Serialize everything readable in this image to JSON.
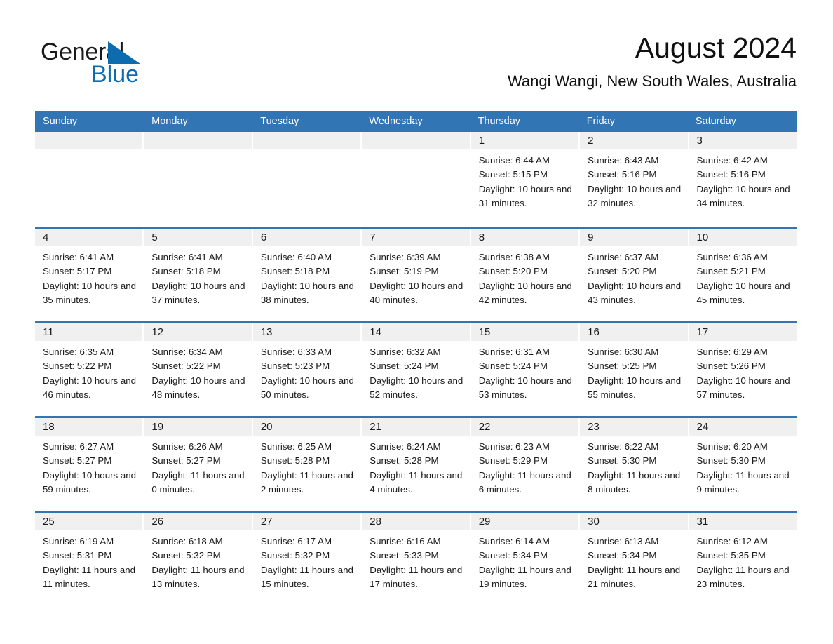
{
  "brand": {
    "name_part1": "General",
    "name_part2": "Blue",
    "triangle_icon": "triangle-icon",
    "accent_color": "#0d6bb0"
  },
  "header": {
    "title": "August 2024",
    "location": "Wangi Wangi, New South Wales, Australia"
  },
  "calendar": {
    "header_color": "#3175b4",
    "weekdays": [
      "Sunday",
      "Monday",
      "Tuesday",
      "Wednesday",
      "Thursday",
      "Friday",
      "Saturday"
    ],
    "weeks": [
      [
        {
          "day": "",
          "empty": true
        },
        {
          "day": "",
          "empty": true
        },
        {
          "day": "",
          "empty": true
        },
        {
          "day": "",
          "empty": true
        },
        {
          "day": "1",
          "sunrise": "Sunrise: 6:44 AM",
          "sunset": "Sunset: 5:15 PM",
          "daylight": "Daylight: 10 hours and 31 minutes."
        },
        {
          "day": "2",
          "sunrise": "Sunrise: 6:43 AM",
          "sunset": "Sunset: 5:16 PM",
          "daylight": "Daylight: 10 hours and 32 minutes."
        },
        {
          "day": "3",
          "sunrise": "Sunrise: 6:42 AM",
          "sunset": "Sunset: 5:16 PM",
          "daylight": "Daylight: 10 hours and 34 minutes."
        }
      ],
      [
        {
          "day": "4",
          "sunrise": "Sunrise: 6:41 AM",
          "sunset": "Sunset: 5:17 PM",
          "daylight": "Daylight: 10 hours and 35 minutes."
        },
        {
          "day": "5",
          "sunrise": "Sunrise: 6:41 AM",
          "sunset": "Sunset: 5:18 PM",
          "daylight": "Daylight: 10 hours and 37 minutes."
        },
        {
          "day": "6",
          "sunrise": "Sunrise: 6:40 AM",
          "sunset": "Sunset: 5:18 PM",
          "daylight": "Daylight: 10 hours and 38 minutes."
        },
        {
          "day": "7",
          "sunrise": "Sunrise: 6:39 AM",
          "sunset": "Sunset: 5:19 PM",
          "daylight": "Daylight: 10 hours and 40 minutes."
        },
        {
          "day": "8",
          "sunrise": "Sunrise: 6:38 AM",
          "sunset": "Sunset: 5:20 PM",
          "daylight": "Daylight: 10 hours and 42 minutes."
        },
        {
          "day": "9",
          "sunrise": "Sunrise: 6:37 AM",
          "sunset": "Sunset: 5:20 PM",
          "daylight": "Daylight: 10 hours and 43 minutes."
        },
        {
          "day": "10",
          "sunrise": "Sunrise: 6:36 AM",
          "sunset": "Sunset: 5:21 PM",
          "daylight": "Daylight: 10 hours and 45 minutes."
        }
      ],
      [
        {
          "day": "11",
          "sunrise": "Sunrise: 6:35 AM",
          "sunset": "Sunset: 5:22 PM",
          "daylight": "Daylight: 10 hours and 46 minutes."
        },
        {
          "day": "12",
          "sunrise": "Sunrise: 6:34 AM",
          "sunset": "Sunset: 5:22 PM",
          "daylight": "Daylight: 10 hours and 48 minutes."
        },
        {
          "day": "13",
          "sunrise": "Sunrise: 6:33 AM",
          "sunset": "Sunset: 5:23 PM",
          "daylight": "Daylight: 10 hours and 50 minutes."
        },
        {
          "day": "14",
          "sunrise": "Sunrise: 6:32 AM",
          "sunset": "Sunset: 5:24 PM",
          "daylight": "Daylight: 10 hours and 52 minutes."
        },
        {
          "day": "15",
          "sunrise": "Sunrise: 6:31 AM",
          "sunset": "Sunset: 5:24 PM",
          "daylight": "Daylight: 10 hours and 53 minutes."
        },
        {
          "day": "16",
          "sunrise": "Sunrise: 6:30 AM",
          "sunset": "Sunset: 5:25 PM",
          "daylight": "Daylight: 10 hours and 55 minutes."
        },
        {
          "day": "17",
          "sunrise": "Sunrise: 6:29 AM",
          "sunset": "Sunset: 5:26 PM",
          "daylight": "Daylight: 10 hours and 57 minutes."
        }
      ],
      [
        {
          "day": "18",
          "sunrise": "Sunrise: 6:27 AM",
          "sunset": "Sunset: 5:27 PM",
          "daylight": "Daylight: 10 hours and 59 minutes."
        },
        {
          "day": "19",
          "sunrise": "Sunrise: 6:26 AM",
          "sunset": "Sunset: 5:27 PM",
          "daylight": "Daylight: 11 hours and 0 minutes."
        },
        {
          "day": "20",
          "sunrise": "Sunrise: 6:25 AM",
          "sunset": "Sunset: 5:28 PM",
          "daylight": "Daylight: 11 hours and 2 minutes."
        },
        {
          "day": "21",
          "sunrise": "Sunrise: 6:24 AM",
          "sunset": "Sunset: 5:28 PM",
          "daylight": "Daylight: 11 hours and 4 minutes."
        },
        {
          "day": "22",
          "sunrise": "Sunrise: 6:23 AM",
          "sunset": "Sunset: 5:29 PM",
          "daylight": "Daylight: 11 hours and 6 minutes."
        },
        {
          "day": "23",
          "sunrise": "Sunrise: 6:22 AM",
          "sunset": "Sunset: 5:30 PM",
          "daylight": "Daylight: 11 hours and 8 minutes."
        },
        {
          "day": "24",
          "sunrise": "Sunrise: 6:20 AM",
          "sunset": "Sunset: 5:30 PM",
          "daylight": "Daylight: 11 hours and 9 minutes."
        }
      ],
      [
        {
          "day": "25",
          "sunrise": "Sunrise: 6:19 AM",
          "sunset": "Sunset: 5:31 PM",
          "daylight": "Daylight: 11 hours and 11 minutes."
        },
        {
          "day": "26",
          "sunrise": "Sunrise: 6:18 AM",
          "sunset": "Sunset: 5:32 PM",
          "daylight": "Daylight: 11 hours and 13 minutes."
        },
        {
          "day": "27",
          "sunrise": "Sunrise: 6:17 AM",
          "sunset": "Sunset: 5:32 PM",
          "daylight": "Daylight: 11 hours and 15 minutes."
        },
        {
          "day": "28",
          "sunrise": "Sunrise: 6:16 AM",
          "sunset": "Sunset: 5:33 PM",
          "daylight": "Daylight: 11 hours and 17 minutes."
        },
        {
          "day": "29",
          "sunrise": "Sunrise: 6:14 AM",
          "sunset": "Sunset: 5:34 PM",
          "daylight": "Daylight: 11 hours and 19 minutes."
        },
        {
          "day": "30",
          "sunrise": "Sunrise: 6:13 AM",
          "sunset": "Sunset: 5:34 PM",
          "daylight": "Daylight: 11 hours and 21 minutes."
        },
        {
          "day": "31",
          "sunrise": "Sunrise: 6:12 AM",
          "sunset": "Sunset: 5:35 PM",
          "daylight": "Daylight: 11 hours and 23 minutes."
        }
      ]
    ]
  }
}
